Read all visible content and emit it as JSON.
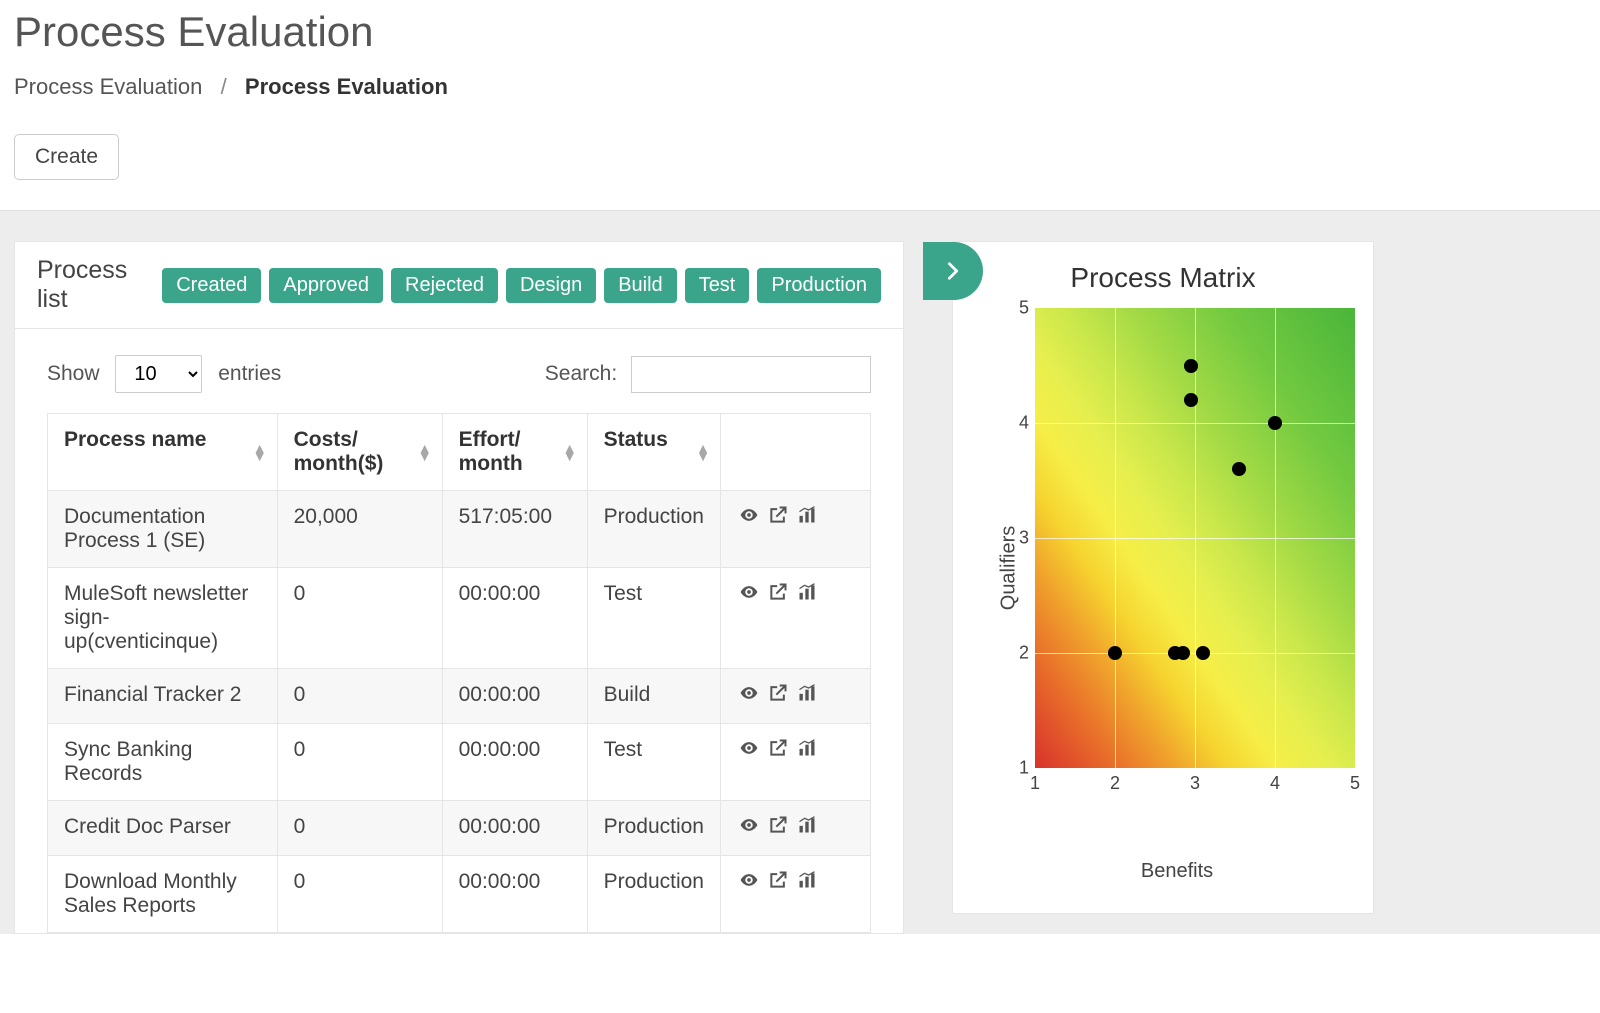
{
  "page": {
    "title": "Process Evaluation",
    "breadcrumb_root": "Process Evaluation",
    "breadcrumb_current": "Process Evaluation"
  },
  "buttons": {
    "create": "Create"
  },
  "list_panel": {
    "title": "Process list",
    "filters": [
      "Created",
      "Approved",
      "Rejected",
      "Design",
      "Build",
      "Test",
      "Production"
    ],
    "show_label_pre": "Show",
    "show_label_post": "entries",
    "show_value": "10",
    "search_label": "Search:",
    "search_value": "",
    "columns": {
      "name": "Process name",
      "costs": "Costs/\nmonth($)",
      "effort": "Effort/\nmonth",
      "status": "Status",
      "actions": ""
    },
    "rows": [
      {
        "name": "Documentation Process 1 (SE)",
        "costs": "20,000",
        "effort": "517:05:00",
        "status": "Production"
      },
      {
        "name": "MuleSoft newsletter sign-up(cventicinque)",
        "costs": "0",
        "effort": "00:00:00",
        "status": "Test"
      },
      {
        "name": "Financial Tracker 2",
        "costs": "0",
        "effort": "00:00:00",
        "status": "Build"
      },
      {
        "name": "Sync Banking Records",
        "costs": "0",
        "effort": "00:00:00",
        "status": "Test"
      },
      {
        "name": "Credit Doc Parser",
        "costs": "0",
        "effort": "00:00:00",
        "status": "Production"
      },
      {
        "name": "Download Monthly Sales Reports",
        "costs": "0",
        "effort": "00:00:00",
        "status": "Production"
      }
    ]
  },
  "chart_data": {
    "type": "scatter",
    "title": "Process Matrix",
    "xlabel": "Benefits",
    "ylabel": "Qualifiers",
    "xlim": [
      1,
      5
    ],
    "ylim": [
      1,
      5
    ],
    "x_ticks": [
      1,
      2,
      3,
      4,
      5
    ],
    "y_ticks": [
      1,
      2,
      3,
      4,
      5
    ],
    "points": [
      {
        "x": 2.0,
        "y": 2.0
      },
      {
        "x": 2.75,
        "y": 2.0
      },
      {
        "x": 2.85,
        "y": 2.0
      },
      {
        "x": 3.1,
        "y": 2.0
      },
      {
        "x": 2.95,
        "y": 4.5
      },
      {
        "x": 2.95,
        "y": 4.2
      },
      {
        "x": 3.55,
        "y": 3.6
      },
      {
        "x": 4.0,
        "y": 4.0
      }
    ]
  }
}
